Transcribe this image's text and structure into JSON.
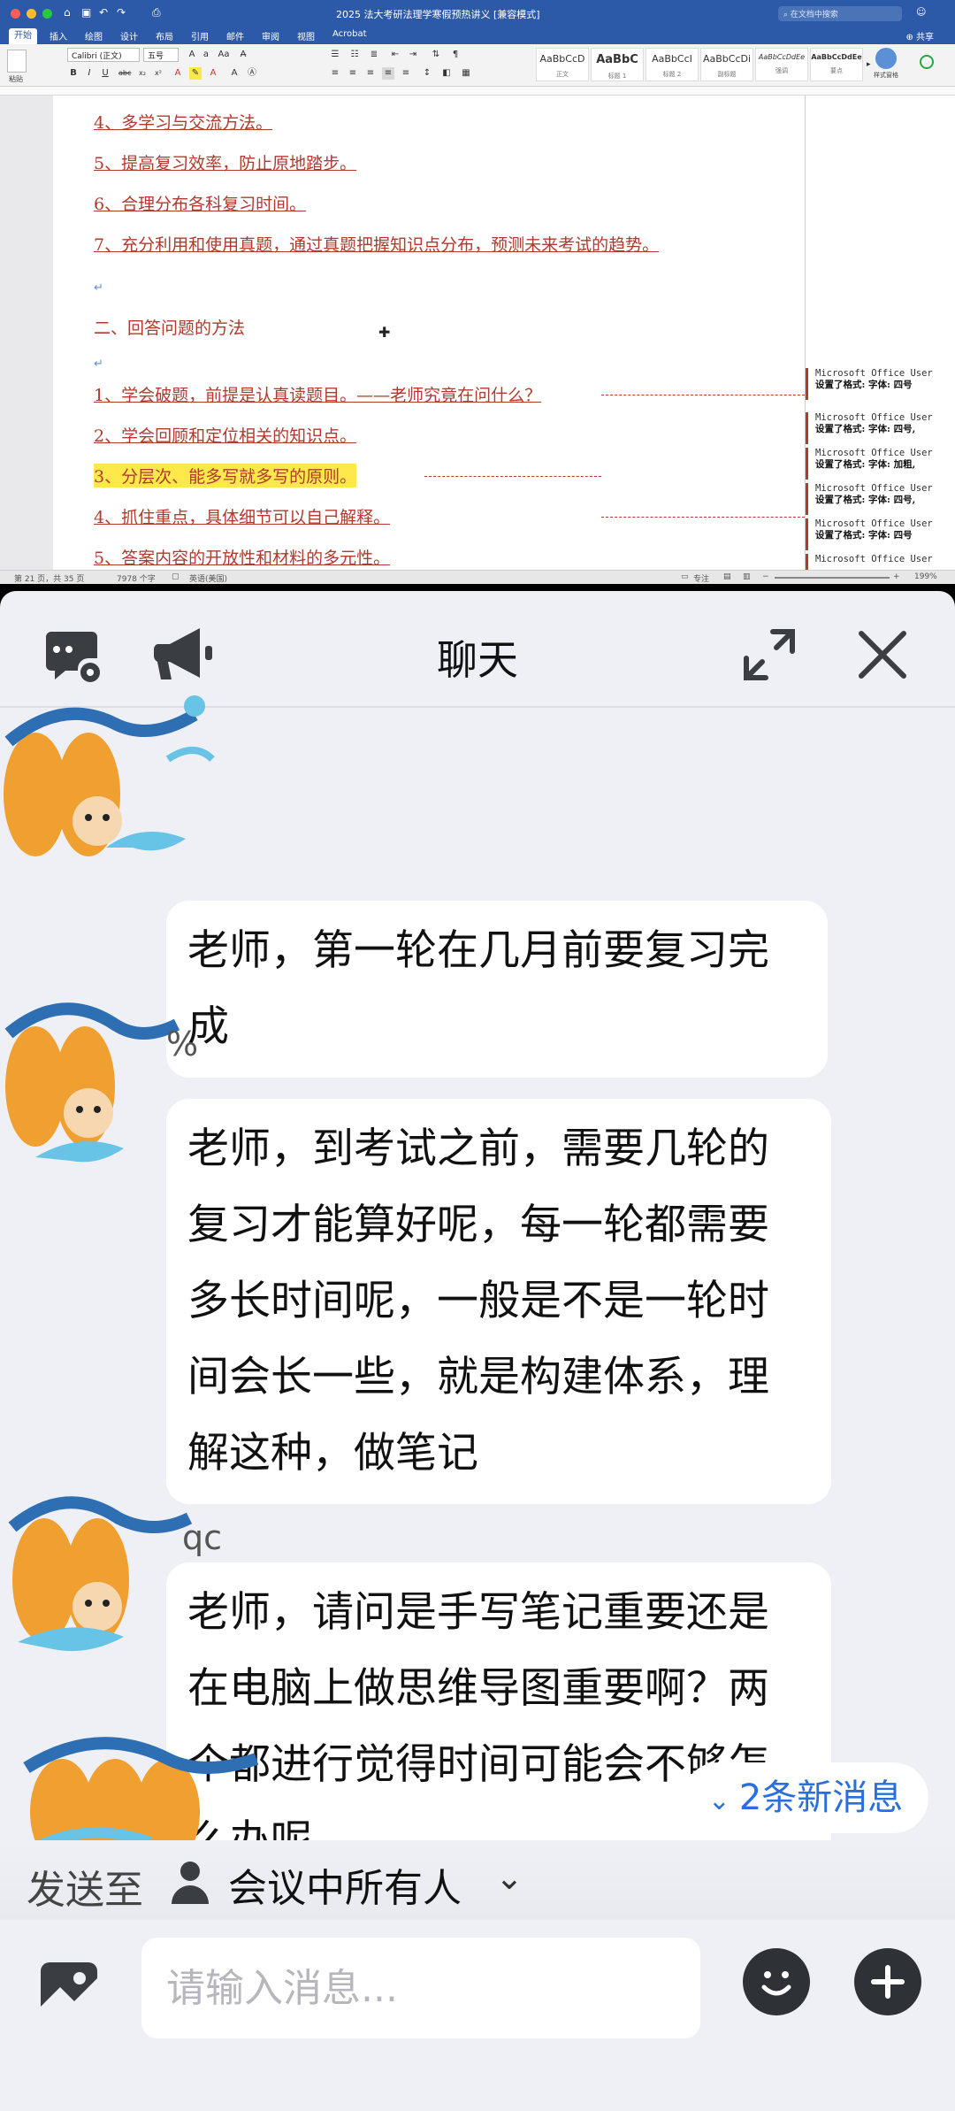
{
  "word": {
    "title": "2025 法大考研法理学寒假预热讲义 [兼容模式]",
    "search_placeholder": "在文档中搜索",
    "share": "共享",
    "tabs": [
      "开始",
      "插入",
      "绘图",
      "设计",
      "布局",
      "引用",
      "邮件",
      "审阅",
      "视图",
      "Acrobat"
    ],
    "font_name": "Calibri (正文)",
    "font_size": "五号",
    "paste_label": "粘贴",
    "styles": [
      {
        "sample": "AaBbCcD",
        "name": "正文"
      },
      {
        "sample": "AaBbC",
        "name": "标题 1"
      },
      {
        "sample": "AaBbCcI",
        "name": "标题 2"
      },
      {
        "sample": "AaBbCcDi",
        "name": "副标题"
      },
      {
        "sample": "AaBbCcDdEe",
        "name": "强调"
      },
      {
        "sample": "AaBbCcDdEe",
        "name": "要点"
      }
    ],
    "styles_pane": "样式窗格",
    "lines": [
      "4、多学习与交流方法。",
      "5、提高复习效率，防止原地踏步。",
      "6、合理分布各科复习时间。",
      "7、充分利用和使用真题，通过真题把握知识点分布，预测未来考试的趋势。",
      "二、回答问题的方法",
      "1、学会破题，前提是认真读题目。——老师究竟在问什么？",
      "2、学会回顾和定位相关的知识点。",
      "3、分层次、能多写就多写的原则。",
      "4、抓住重点，具体细节可以自己解释。",
      "5、答案内容的开放性和材料的多元性。"
    ],
    "comments": [
      {
        "author": "Microsoft Office User",
        "text": "设置了格式: 字体: 四号"
      },
      {
        "author": "Microsoft Office User",
        "text": "设置了格式: 字体: 四号,"
      },
      {
        "author": "Microsoft Office User",
        "text": "设置了格式: 字体: 加粗,"
      },
      {
        "author": "Microsoft Office User",
        "text": "设置了格式: 字体: 四号,"
      },
      {
        "author": "Microsoft Office User",
        "text": "设置了格式: 字体: 四号"
      },
      {
        "author": "Microsoft Office User",
        "text": ""
      }
    ],
    "status": {
      "page": "第 21 页，共 35 页",
      "words": "7978 个字",
      "language": "英语(美国)",
      "focus": "专注",
      "zoom": "199%"
    }
  },
  "chat": {
    "title": "聊天",
    "messages": [
      {
        "sender": "",
        "text": "老师，第一轮在几月前要复习完成"
      },
      {
        "sender": "%",
        "text": "老师，到考试之前，需要几轮的复习才能算好呢，每一轮都需要多长时间呢，一般是不是一轮时间会长一些，就是构建体系，理解这种，做笔记"
      },
      {
        "sender": "qc",
        "text": "老师，请问是手写笔记重要还是在电脑上做思维导图重要啊？两个都进行觉得时间可能会不够怎么办呢"
      }
    ],
    "new_messages": "2条新消息",
    "send_to_prefix": "发送至",
    "send_to_target": "会议中所有人",
    "input_placeholder": "请输入消息..."
  },
  "colors": {
    "word_blue": "#2d5aa8",
    "doc_red": "#b03a2e",
    "highlight": "#ffe84a",
    "chat_bg": "#eff0f5",
    "link_blue": "#2a6fdb"
  }
}
